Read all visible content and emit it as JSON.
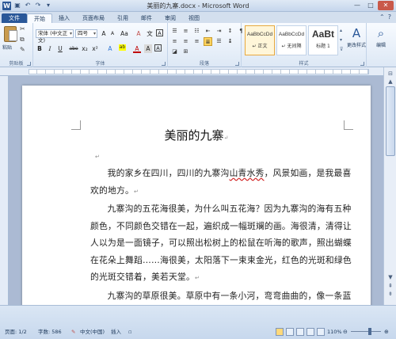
{
  "app": {
    "title": "美丽的九寨.docx - Microsoft Word",
    "icon_letter": "W"
  },
  "window_controls": {
    "minimize": "—",
    "maximize": "□",
    "close": "✕"
  },
  "qat": [
    "save-icon",
    "undo-icon",
    "redo-icon",
    "dropdown-icon"
  ],
  "tabs": [
    "文件",
    "开始",
    "插入",
    "页面布局",
    "引用",
    "邮件",
    "审阅",
    "视图"
  ],
  "ribbon": {
    "clipboard": {
      "label": "剪贴板",
      "paste": "粘贴"
    },
    "font": {
      "label": "字体",
      "font_name": "宋体 (中文正文)",
      "font_size": "四号",
      "bold": "B",
      "italic": "I",
      "underline": "U",
      "strike": "abe",
      "sub": "x₂",
      "sup": "x²",
      "grow": "A",
      "shrink": "A",
      "clear": "A",
      "color_a": "A"
    },
    "paragraph": {
      "label": "段落"
    },
    "styles": {
      "label": "样式",
      "items": [
        {
          "sample": "AaBbCcDd",
          "name": "↵ 正文"
        },
        {
          "sample": "AaBbCcDd",
          "name": "↵ 无间隔"
        },
        {
          "sample": "AaBt",
          "name": "标题 1"
        }
      ],
      "change_styles": "更改样式"
    },
    "editing": {
      "label": "编辑"
    }
  },
  "document": {
    "title": "美丽的九寨",
    "paragraphs": [
      {
        "before": "我的家乡在四川，四川的九寨沟",
        "underlined": "山青水秀",
        "after": "，风景如画，是我最喜欢的地方。"
      },
      {
        "text": "九寨沟的五花海很美，为什么叫五花海？因为九寨沟的海有五种颜色，不同颜色交错在一起，遍织成一幅斑斓的画。海很清，清得让人以为是一面镜子，可以照出松树上的松鼠在听海的歌声，照出蝴蝶在花朵上舞蹈……海很美，太阳落下一束束金光，红色的光斑和绿色的光斑交错着，美若天堂。"
      },
      {
        "text": "九寨沟的草原很美。草原中有一条小河，弯弯曲曲的，像一条蓝"
      }
    ],
    "para_mark": "↵"
  },
  "status": {
    "page": "页面: 1/2",
    "words": "字数: 586",
    "language": "中文(中国)",
    "mode": "插入",
    "zoom": "110%",
    "zoom_out": "⊖",
    "zoom_in": "⊕"
  }
}
